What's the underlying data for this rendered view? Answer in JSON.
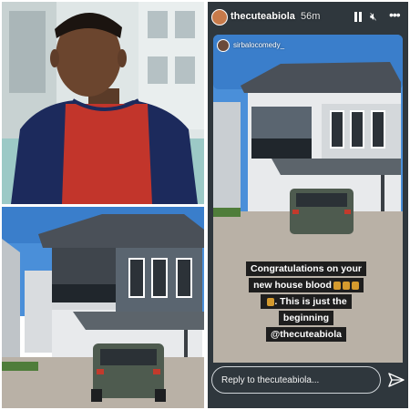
{
  "story": {
    "username": "thecuteabiola",
    "time": "56m",
    "mentioned_username": "sirbalocomedy_",
    "caption_lines": [
      "Congratulations on your",
      "new house blood",
      ". This is just the",
      "beginning",
      "@thecuteabiola"
    ],
    "reply_placeholder": "Reply to thecuteabiola...",
    "icons": [
      "pause-icon",
      "mute-icon",
      "more-icon",
      "send-icon"
    ]
  },
  "colors": {
    "sweater_red": "#c2352b",
    "sweater_navy": "#1c2a5c",
    "sky": "#4a8fd9",
    "roof": "#4a5058",
    "car": "#4e5b4f"
  }
}
